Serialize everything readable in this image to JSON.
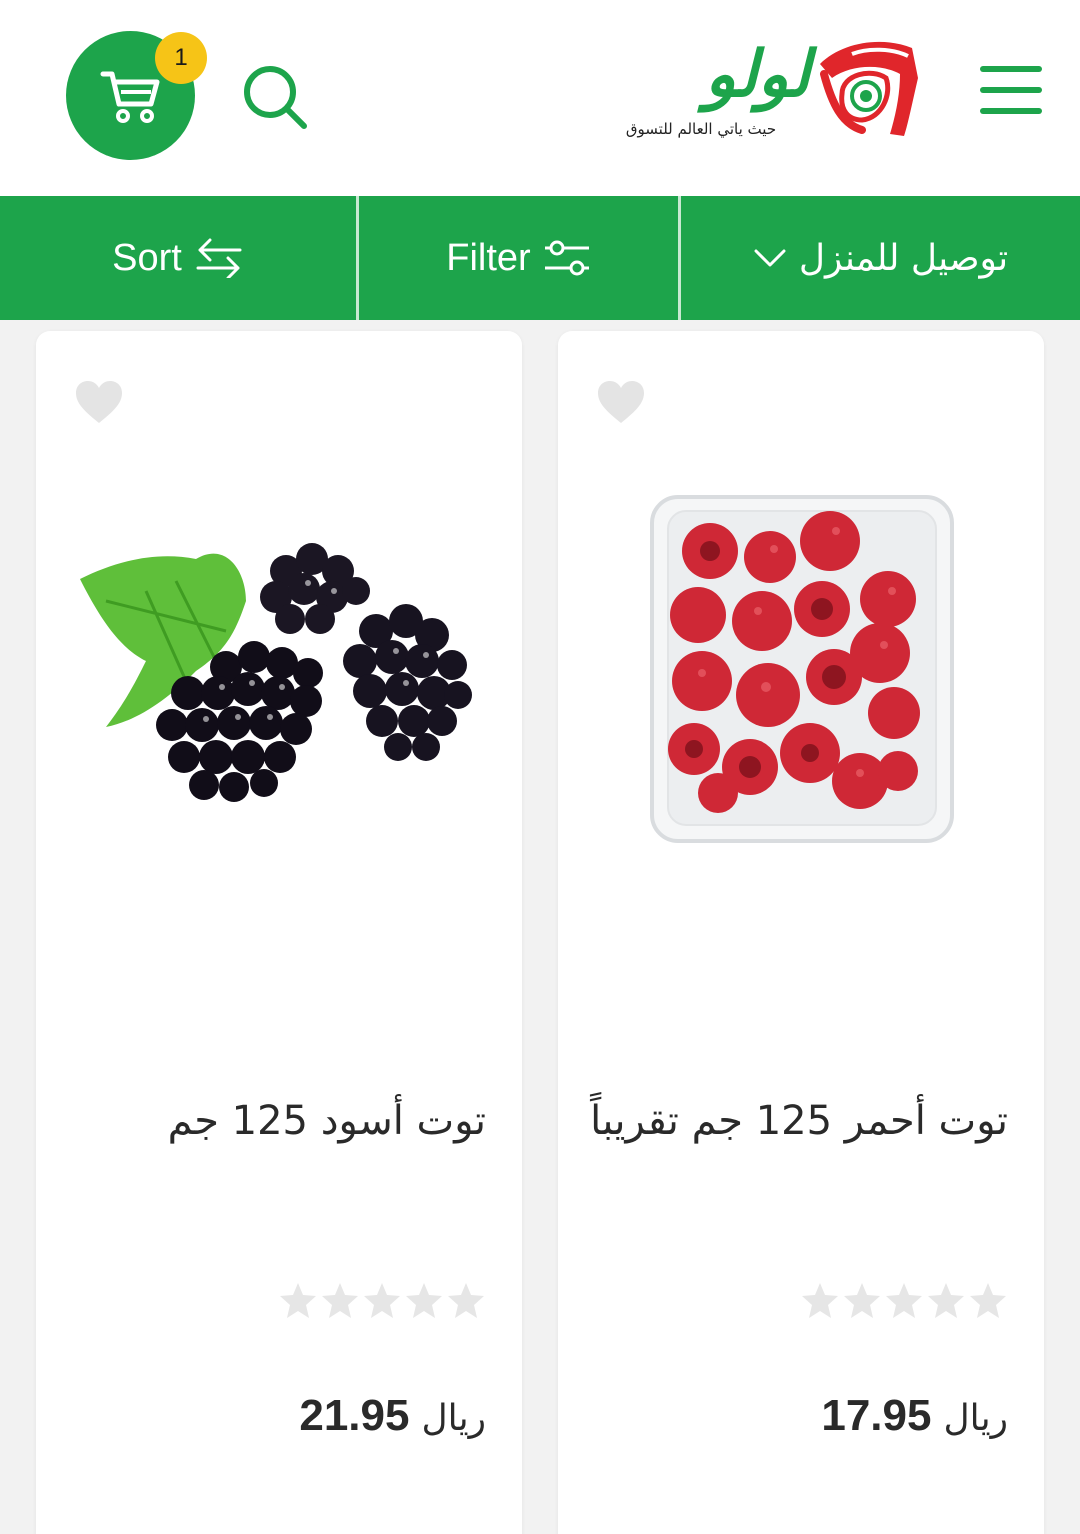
{
  "header": {
    "cart_count": "1",
    "logo_text": "لولو",
    "logo_tagline": "حيث ياتي العالم للتسوق"
  },
  "toolbar": {
    "sort_label": "Sort",
    "filter_label": "Filter",
    "delivery_label": "توصيل للمنزل"
  },
  "colors": {
    "brand_green": "#1da44b",
    "badge_yellow": "#f6c417",
    "logo_red": "#e0262b"
  },
  "products": [
    {
      "name": "توت أحمر 125 جم تقريباً",
      "price": "17.95",
      "currency": "ريال",
      "rating": 0,
      "image_icon": "raspberries-image"
    },
    {
      "name": "توت أسود 125 جم",
      "price": "21.95",
      "currency": "ريال",
      "rating": 0,
      "image_icon": "blackberries-image"
    }
  ]
}
